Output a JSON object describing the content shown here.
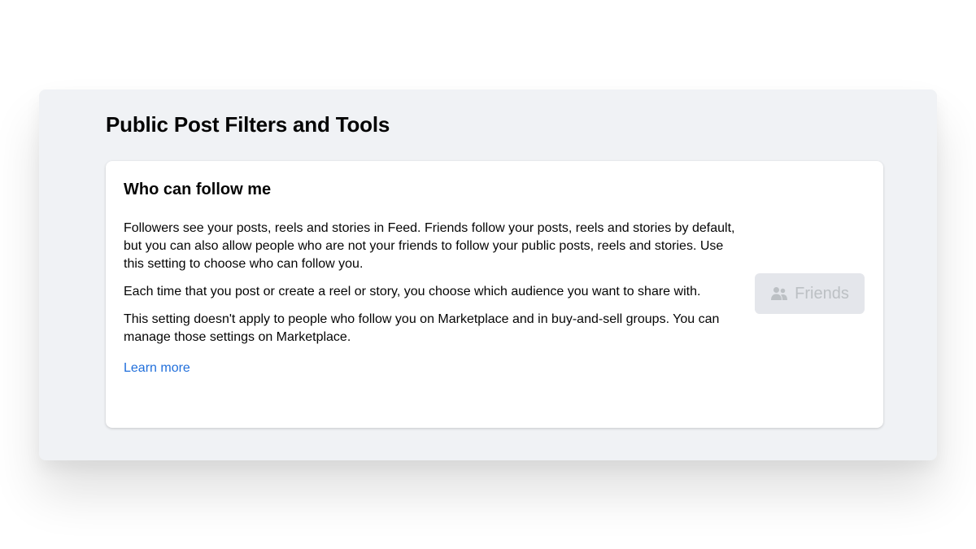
{
  "panel": {
    "title": "Public Post Filters and Tools"
  },
  "card": {
    "title": "Who can follow me",
    "paragraphs": [
      "Followers see your posts, reels and stories in Feed. Friends follow your posts, reels and stories by default, but you can also allow people who are not your friends to follow your public posts, reels and stories. Use this setting to choose who can follow you.",
      "Each time that you post or create a reel or story, you choose which audience you want to share with.",
      "This setting doesn't apply to people who follow you on Marketplace and in buy-and-sell groups. You can manage those settings on Marketplace."
    ],
    "learn_more": "Learn more"
  },
  "audience_button": {
    "label": "Friends",
    "icon": "friends-icon",
    "state": "disabled"
  },
  "colors": {
    "panel_bg": "#f0f2f5",
    "card_bg": "#ffffff",
    "link": "#216fdb",
    "button_bg": "#e4e6eb",
    "button_text": "#bcc0c4"
  }
}
